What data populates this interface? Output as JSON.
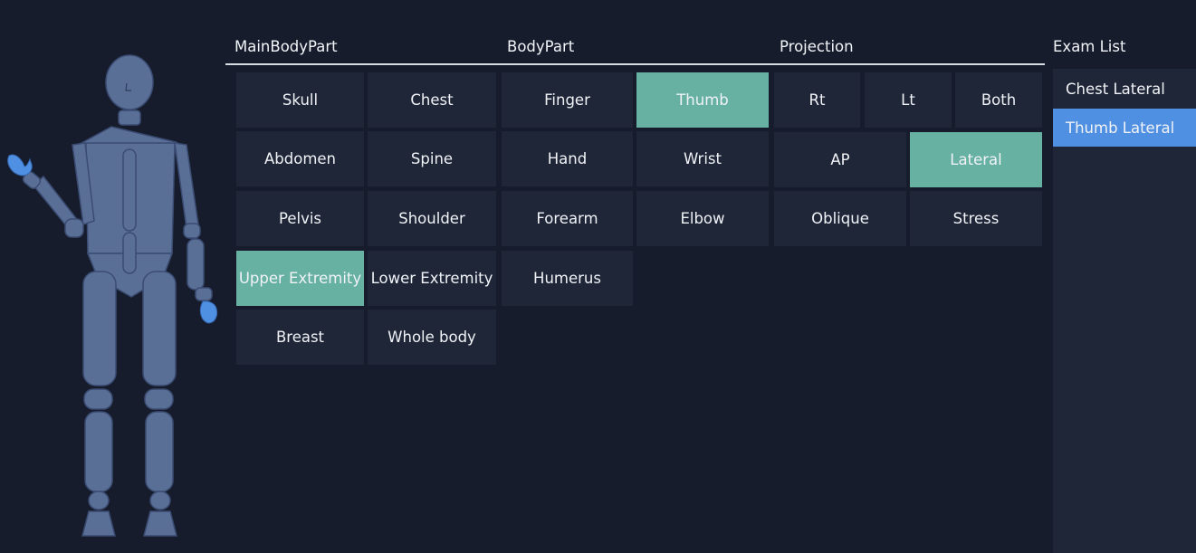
{
  "headers": {
    "main_body_part": "MainBodyPart",
    "body_part": "BodyPart",
    "projection": "Projection",
    "exam_list": "Exam List"
  },
  "main_body_parts": [
    "Skull",
    "Chest",
    "Abdomen",
    "Spine",
    "Pelvis",
    "Shoulder",
    "Upper Extremity",
    "Lower Extremity",
    "Breast",
    "Whole body"
  ],
  "main_body_part_selected": "Upper Extremity",
  "body_parts": [
    "Finger",
    "Thumb",
    "Hand",
    "Wrist",
    "Forearm",
    "Elbow",
    "Humerus"
  ],
  "body_part_selected": "Thumb",
  "projection_sides": [
    "Rt",
    "Lt",
    "Both"
  ],
  "projections": [
    "AP",
    "Lateral",
    "Oblique",
    "Stress"
  ],
  "projection_selected": "Lateral",
  "exam_list": [
    "Chest Lateral",
    "Thumb Lateral"
  ],
  "exam_selected": "Thumb Lateral",
  "colors": {
    "background": "#161c2c",
    "tile": "#1e2638",
    "tile_selected": "#66b1a2",
    "exam_selected": "#4f90e2",
    "body_figure": "#5a6f96",
    "body_highlight": "#4f90e2"
  },
  "figure": {
    "highlighted_parts": [
      "right-hand",
      "left-hand"
    ]
  }
}
